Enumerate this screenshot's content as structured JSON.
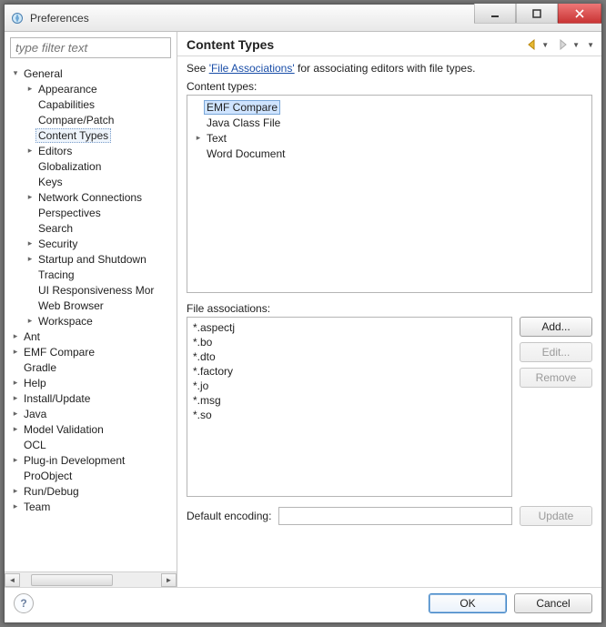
{
  "window": {
    "title": "Preferences"
  },
  "filter": {
    "placeholder": "type filter text"
  },
  "tree": {
    "general": "General",
    "general_children": [
      "Appearance",
      "Capabilities",
      "Compare/Patch",
      "Content Types",
      "Editors",
      "Globalization",
      "Keys",
      "Network Connections",
      "Perspectives",
      "Search",
      "Security",
      "Startup and Shutdown",
      "Tracing",
      "UI Responsiveness Mor",
      "Web Browser",
      "Workspace"
    ],
    "general_expandable": [
      true,
      false,
      false,
      false,
      true,
      false,
      false,
      true,
      false,
      false,
      true,
      true,
      false,
      false,
      false,
      true
    ],
    "top_items": [
      "Ant",
      "EMF Compare",
      "Gradle",
      "Help",
      "Install/Update",
      "Java",
      "Model Validation",
      "OCL",
      "Plug-in Development",
      "ProObject",
      "Run/Debug",
      "Team"
    ],
    "top_expandable": [
      true,
      true,
      false,
      true,
      true,
      true,
      true,
      false,
      true,
      false,
      true,
      true
    ],
    "selected": "Content Types"
  },
  "page": {
    "title": "Content Types",
    "see_prefix": "See ",
    "see_link": "'File Associations'",
    "see_suffix": " for associating editors with file types.",
    "content_types_label": "Content types:",
    "content_types": [
      {
        "label": "EMF Compare",
        "expandable": false,
        "selected": true
      },
      {
        "label": "Java Class File",
        "expandable": false,
        "selected": false
      },
      {
        "label": "Text",
        "expandable": true,
        "selected": false
      },
      {
        "label": "Word Document",
        "expandable": false,
        "selected": false
      }
    ],
    "file_assoc_label": "File associations:",
    "file_associations": [
      "*.aspectj",
      "*.bo",
      "*.dto",
      "*.factory",
      "*.jo",
      "*.msg",
      "*.so"
    ],
    "buttons": {
      "add": "Add...",
      "edit": "Edit...",
      "remove": "Remove",
      "update": "Update"
    },
    "encoding_label": "Default encoding:",
    "encoding_value": ""
  },
  "footer": {
    "ok": "OK",
    "cancel": "Cancel"
  }
}
